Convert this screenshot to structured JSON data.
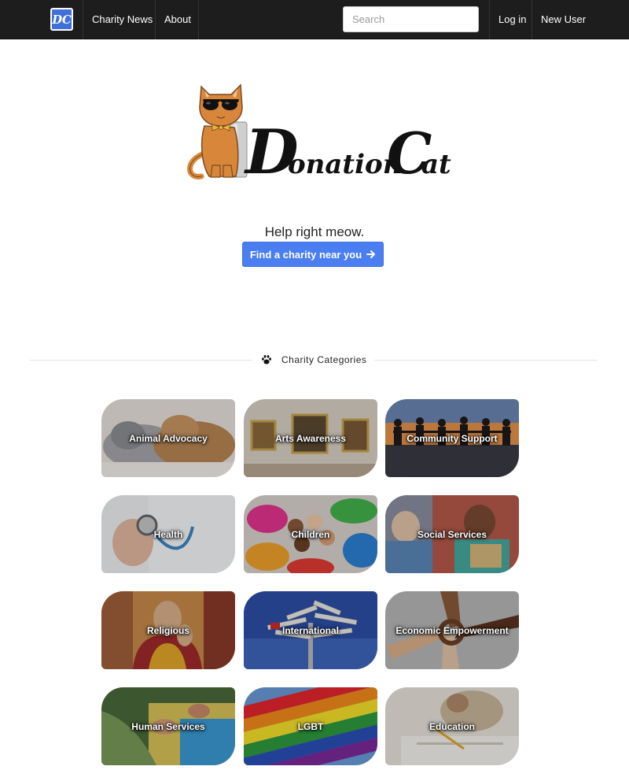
{
  "nav": {
    "brand_monogram": "DC",
    "links": [
      {
        "label": "Charity News"
      },
      {
        "label": "About"
      }
    ],
    "search_placeholder": "Search",
    "login_label": "Log in",
    "new_user_label": "New User"
  },
  "hero": {
    "logo_text": "DonationCat",
    "tagline": "Help right meow.",
    "cta_label": "Find a charity near you",
    "cta_icon": "arrow-right-icon"
  },
  "section": {
    "title": "Charity Categories",
    "icon": "paw-icon"
  },
  "categories": [
    {
      "label": "Animal Advocacy"
    },
    {
      "label": "Arts Awareness"
    },
    {
      "label": "Community Support"
    },
    {
      "label": "Health"
    },
    {
      "label": "Children"
    },
    {
      "label": "Social Services"
    },
    {
      "label": "Religious"
    },
    {
      "label": "International"
    },
    {
      "label": "Economic Empowerment"
    },
    {
      "label": "Human Services"
    },
    {
      "label": "LGBT"
    },
    {
      "label": "Education"
    }
  ],
  "colors": {
    "navbar": "#1d1d1d",
    "accent": "#4a7ef1",
    "brand": "#3f6fd8"
  }
}
